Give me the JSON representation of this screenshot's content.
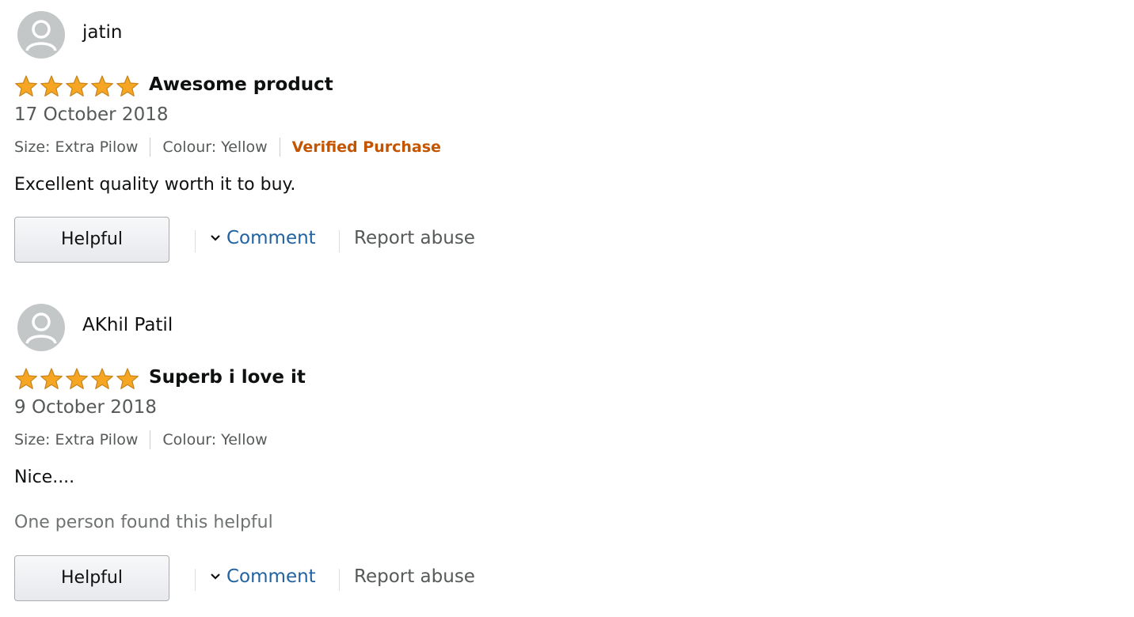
{
  "reviews": [
    {
      "author": "jatin",
      "avatar_icon": "user-silhouette-icon",
      "stars": 5,
      "title": "Awesome product",
      "date": "17 October 2018",
      "size": "Size: Extra Pilow",
      "colour": "Colour: Yellow",
      "verified": "Verified Purchase",
      "body": "Excellent quality worth it to buy.",
      "helpful_count": "",
      "helpful_label": "Helpful",
      "comment_label": "Comment",
      "report_label": "Report abuse"
    },
    {
      "author": "AKhil Patil",
      "avatar_icon": "user-silhouette-icon",
      "stars": 5,
      "title": "Superb i love it",
      "date": "9 October 2018",
      "size": "Size: Extra Pilow",
      "colour": "Colour: Yellow",
      "verified": "",
      "body": "Nice....",
      "helpful_count": "One person found this helpful",
      "helpful_label": "Helpful",
      "comment_label": "Comment",
      "report_label": "Report abuse"
    }
  ],
  "colors": {
    "star_fill": "#f5a623",
    "star_stroke": "#c9831a",
    "verified": "#c45500",
    "link": "#2162a1",
    "muted": "#565959"
  }
}
